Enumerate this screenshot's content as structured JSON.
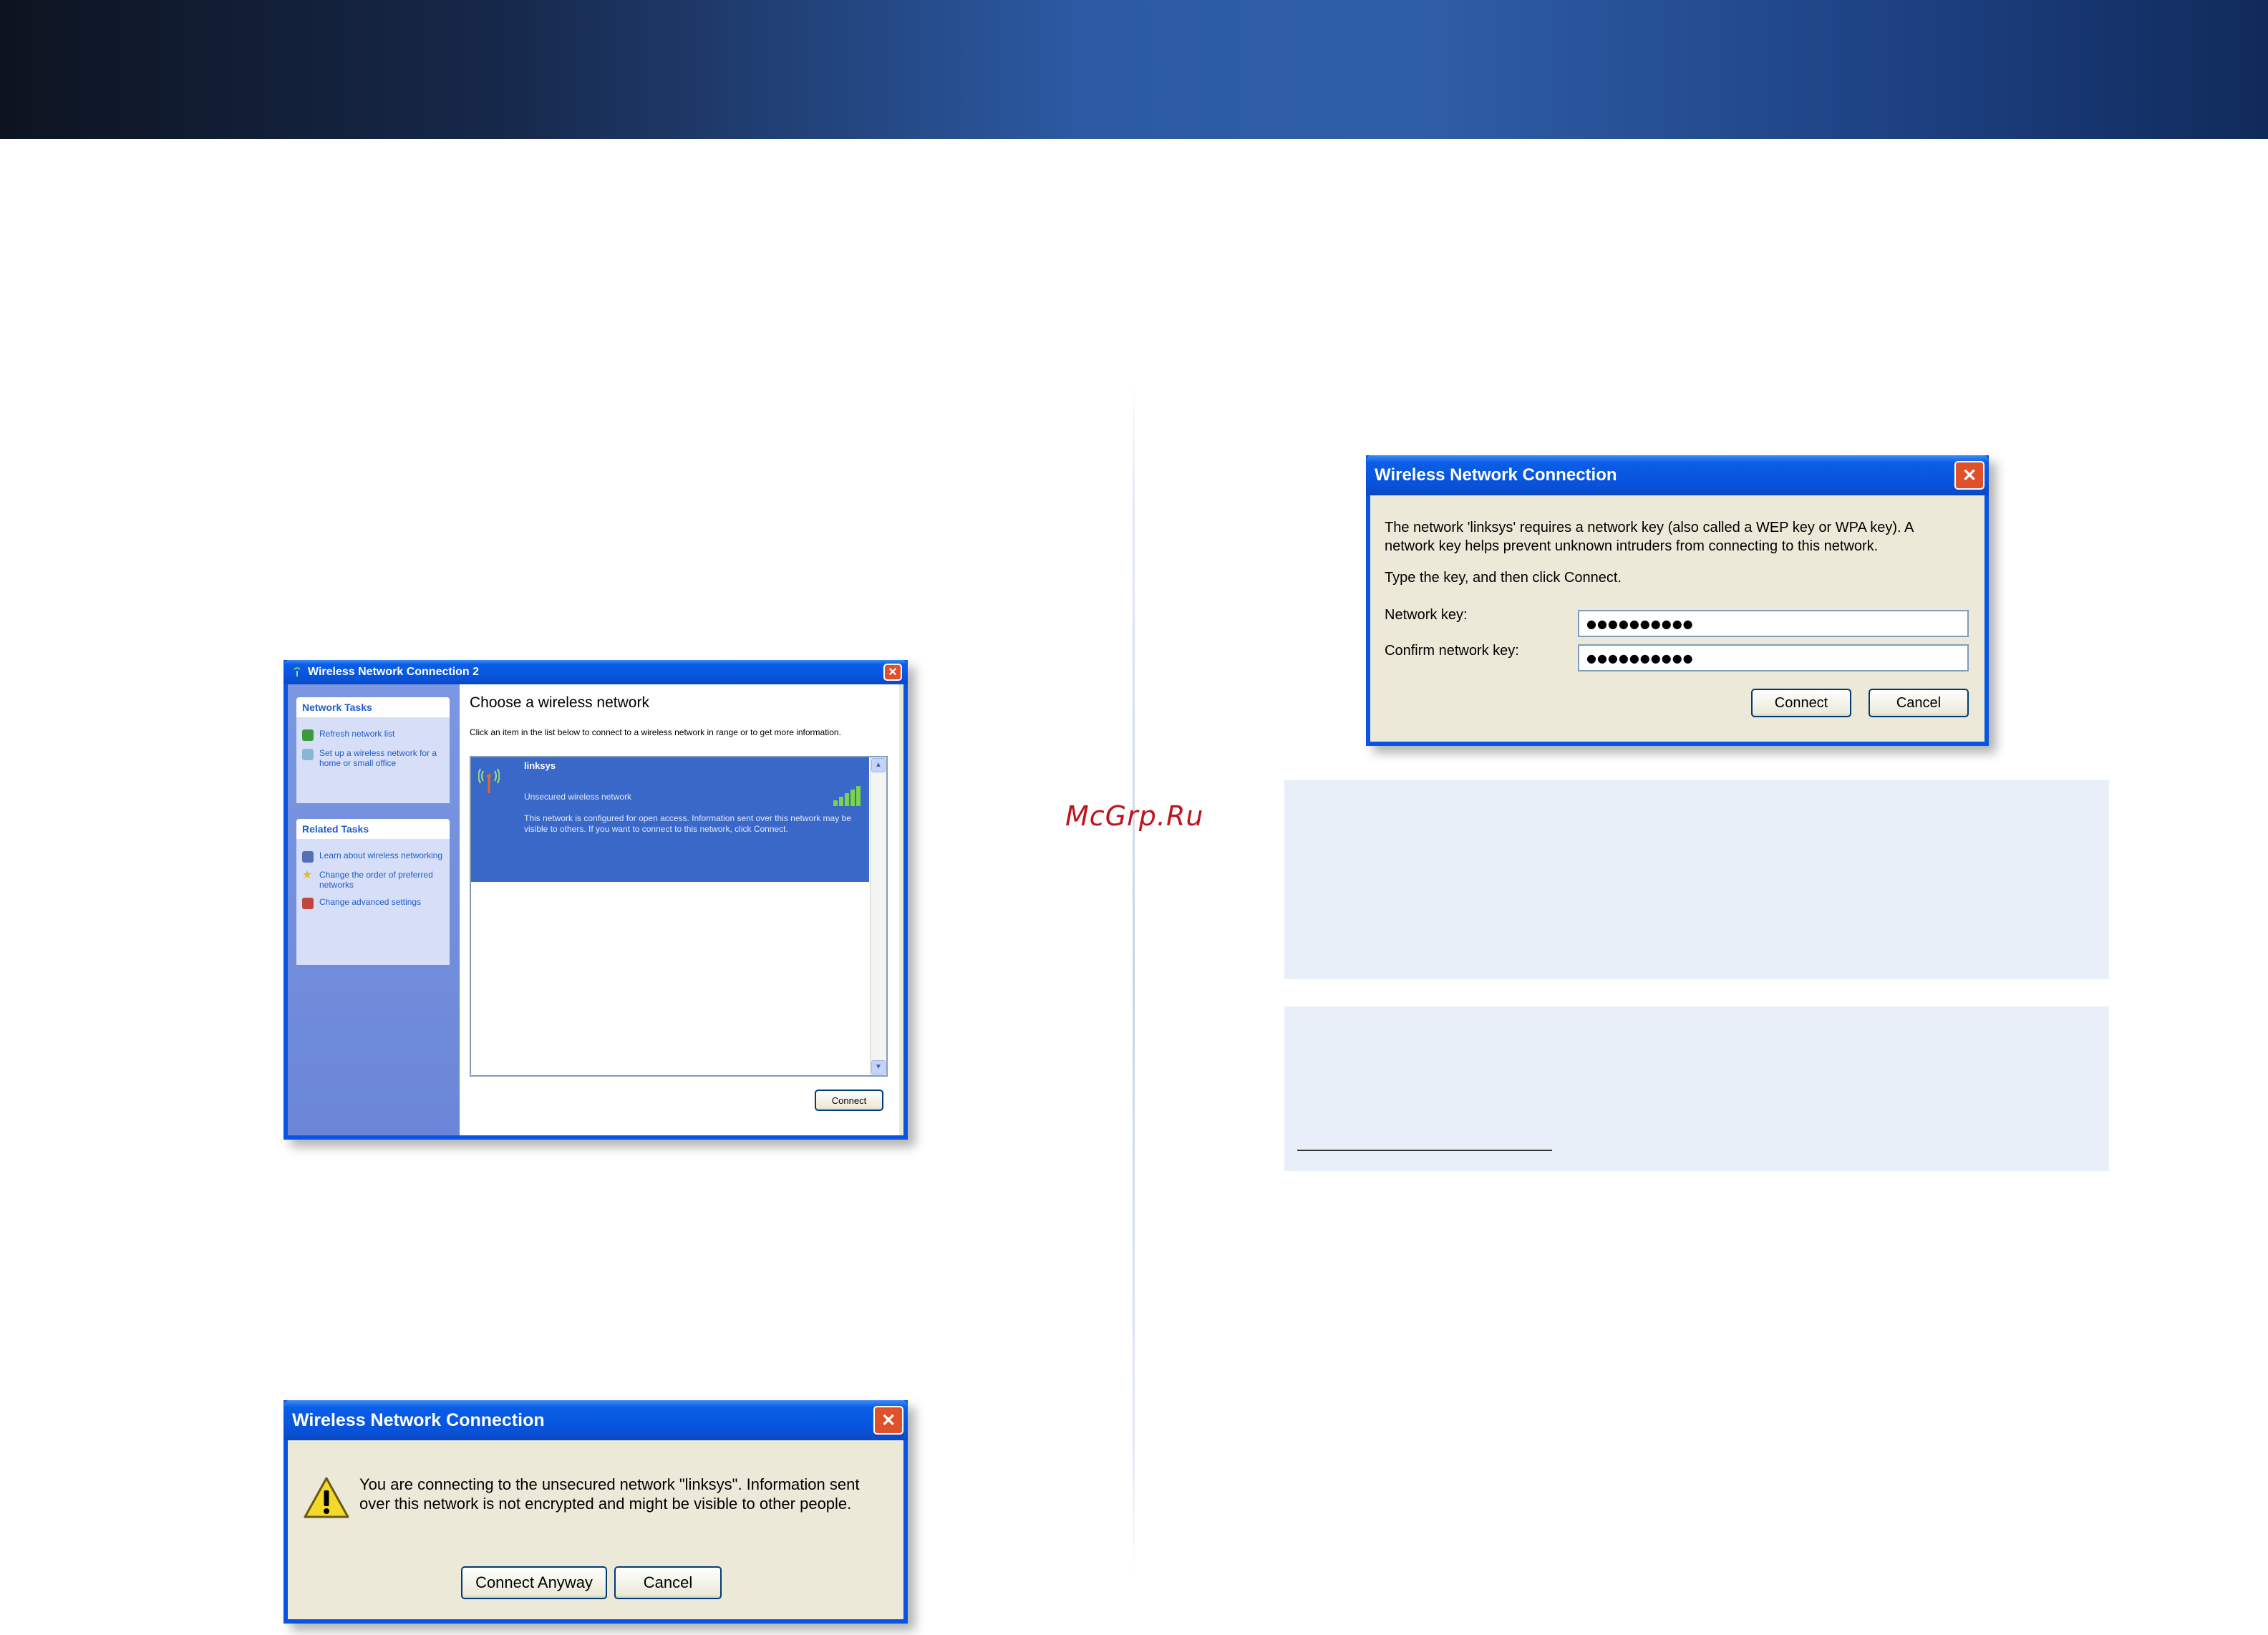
{
  "watermark": "McGrp.Ru",
  "window1": {
    "title": "Wireless Network Connection 2",
    "network_tasks_header": "Network Tasks",
    "network_tasks": [
      {
        "icon": "refresh-icon",
        "label": "Refresh network list"
      },
      {
        "icon": "setup-network-icon",
        "label": "Set up a wireless network for a home or small office"
      }
    ],
    "related_tasks_header": "Related Tasks",
    "related_tasks": [
      {
        "icon": "learn-icon",
        "label": "Learn about wireless networking"
      },
      {
        "icon": "star-icon",
        "label": "Change the order of preferred networks"
      },
      {
        "icon": "settings-icon",
        "label": "Change advanced settings"
      }
    ],
    "heading": "Choose a wireless network",
    "instruction": "Click an item in the list below to connect to a wireless network in range or to get more information.",
    "network": {
      "name": "linksys",
      "security": "Unsecured wireless network",
      "description": "This network is configured for open access. Information sent over this network may be visible to others. If you want to connect to this network, click Connect.",
      "signal_bars": 5,
      "signal_bars_total": 5
    },
    "connect_label": "Connect"
  },
  "window2": {
    "title": "Wireless Network Connection",
    "message": "You are connecting to the unsecured network \"linksys\". Information sent over this network is not encrypted and might be visible to other people.",
    "connect_anyway_label": "Connect Anyway",
    "cancel_label": "Cancel"
  },
  "window3": {
    "title": "Wireless Network Connection",
    "message": "The network 'linksys' requires a network key (also called a WEP key or WPA key). A network key helps prevent unknown intruders from connecting to this network.",
    "instruction": "Type the key, and then click Connect.",
    "network_key_label": "Network key:",
    "network_key_value": "●●●●●●●●●●",
    "confirm_key_label": "Confirm network key:",
    "confirm_key_value": "●●●●●●●●●●",
    "connect_label": "Connect",
    "cancel_label": "Cancel"
  },
  "colors": {
    "xp_blue": "#0854e3",
    "xp_face": "#ece9d8",
    "task_pane": "#7b97e0",
    "selected_network": "#3a68c8",
    "close_red": "#e0502a",
    "watermark_red": "#c0141c",
    "info_box": "#e9eff9"
  }
}
